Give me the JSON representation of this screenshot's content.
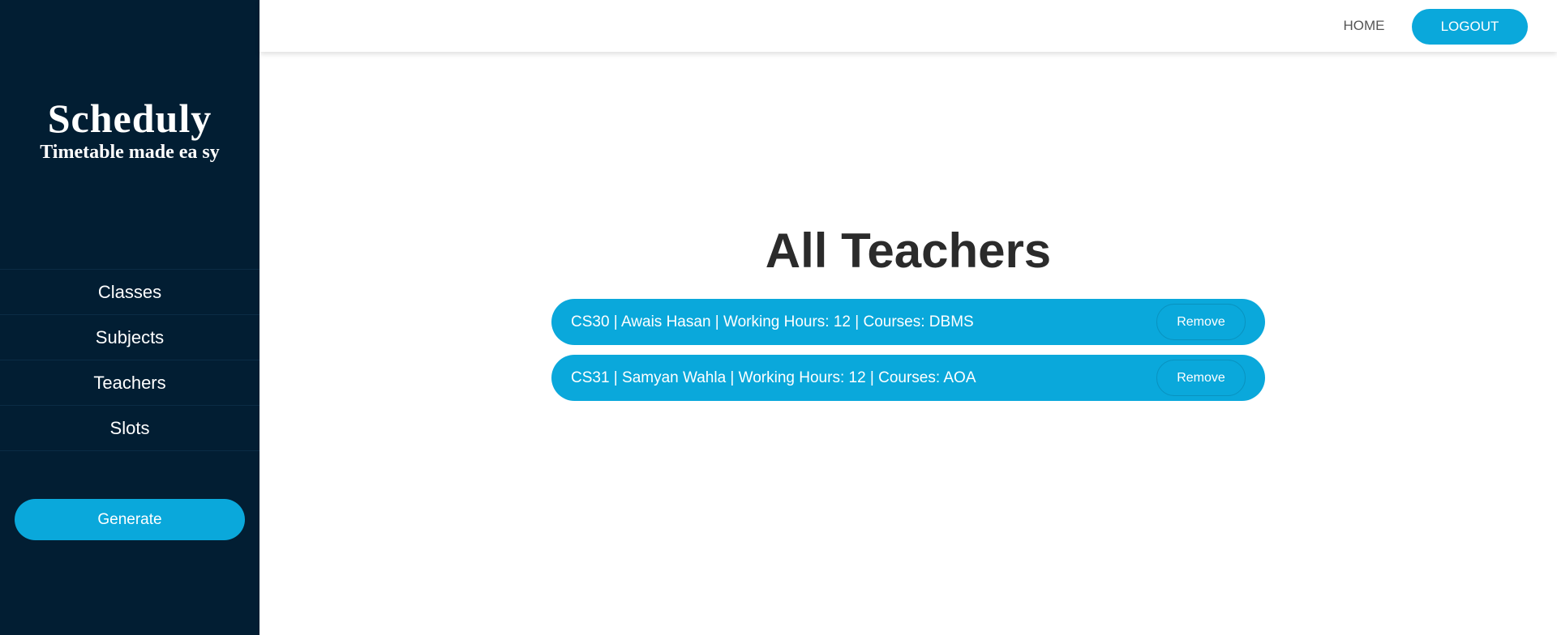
{
  "colors": {
    "sidebar_bg": "#021e33",
    "accent": "#0aa8db",
    "title_text": "#2b2b2b"
  },
  "sidebar": {
    "brand_title": "Scheduly",
    "brand_tagline": "Timetable made ea sy",
    "nav_items": [
      {
        "label": "Classes"
      },
      {
        "label": "Subjects"
      },
      {
        "label": "Teachers"
      },
      {
        "label": "Slots"
      }
    ],
    "generate_label": "Generate"
  },
  "header": {
    "home_label": "HOME",
    "logout_label": "LOGOUT"
  },
  "main": {
    "title": "All Teachers",
    "teachers": [
      {
        "text": "CS30 | Awais Hasan | Working Hours: 12 | Courses: DBMS",
        "remove_label": "Remove"
      },
      {
        "text": "CS31 | Samyan Wahla | Working Hours: 12 | Courses: AOA",
        "remove_label": "Remove"
      }
    ]
  }
}
